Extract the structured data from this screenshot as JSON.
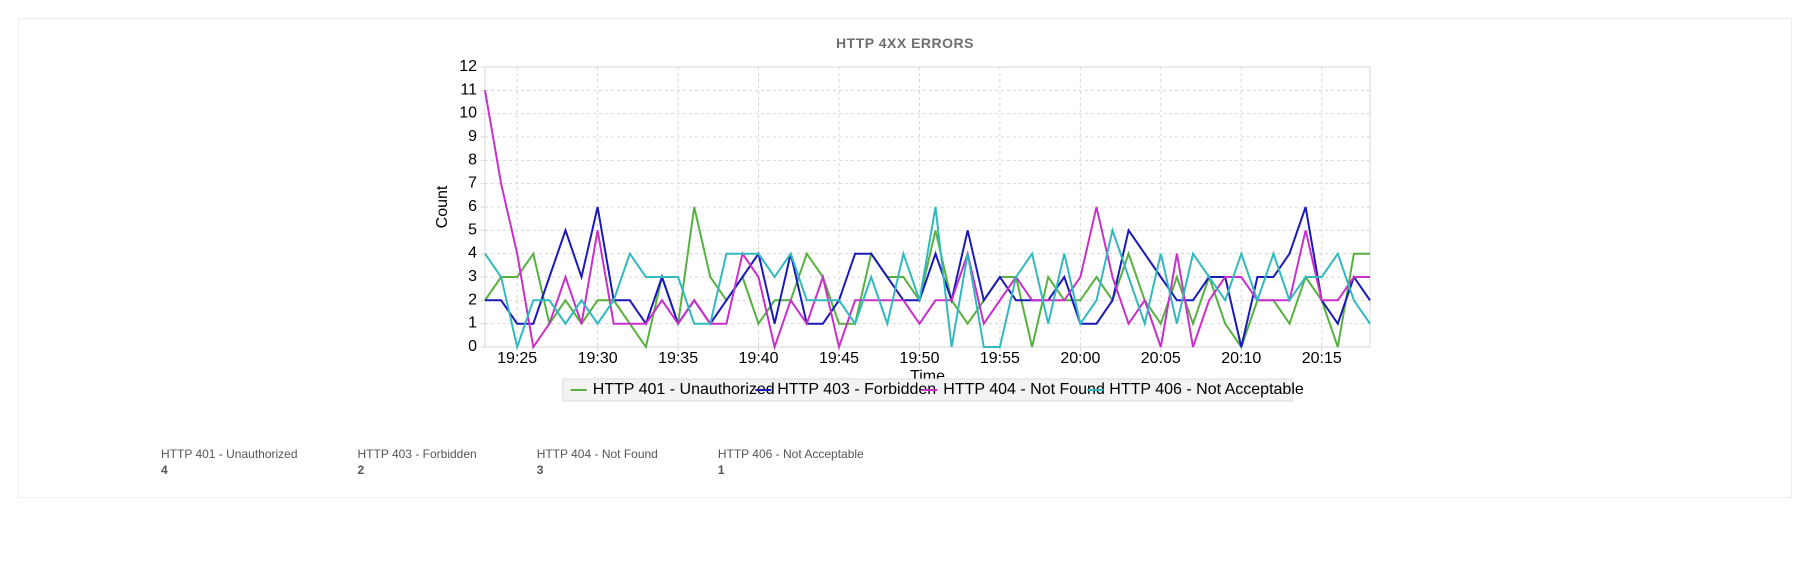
{
  "title": "HTTP 4XX ERRORS",
  "xlabel": "Time",
  "ylabel": "Count",
  "x_ticks": [
    "19:25",
    "19:30",
    "19:35",
    "19:40",
    "19:45",
    "19:50",
    "19:55",
    "20:00",
    "20:05",
    "20:10",
    "20:15"
  ],
  "y_ticks": [
    0,
    1,
    2,
    3,
    4,
    5,
    6,
    7,
    8,
    9,
    10,
    11,
    12
  ],
  "legend": [
    {
      "name": "HTTP 401 - Unauthorized",
      "color": "#57b140"
    },
    {
      "name": "HTTP 403 - Forbidden",
      "color": "#1a1ab8"
    },
    {
      "name": "HTTP 404 - Not Found",
      "color": "#c930c9"
    },
    {
      "name": "HTTP 406 - Not Acceptable",
      "color": "#32b9bf"
    }
  ],
  "stats": [
    {
      "label": "HTTP 401 - Unauthorized",
      "value": "4"
    },
    {
      "label": "HTTP 403 - Forbidden",
      "value": "2"
    },
    {
      "label": "HTTP 404 - Not Found",
      "value": "3"
    },
    {
      "label": "HTTP 406 - Not Acceptable",
      "value": "1"
    }
  ],
  "chart_data": {
    "type": "line",
    "title": "HTTP 4XX ERRORS",
    "xlabel": "Time",
    "ylabel": "Count",
    "ylim": [
      0,
      12
    ],
    "x": [
      0,
      1,
      2,
      3,
      4,
      5,
      6,
      7,
      8,
      9,
      10,
      11,
      12,
      13,
      14,
      15,
      16,
      17,
      18,
      19,
      20,
      21,
      22,
      23,
      24,
      25,
      26,
      27,
      28,
      29,
      30,
      31,
      32,
      33,
      34,
      35,
      36,
      37,
      38,
      39,
      40,
      41,
      42,
      43,
      44,
      45,
      46,
      47,
      48,
      49,
      50,
      51,
      52,
      53,
      54,
      55
    ],
    "x_tick_positions": [
      2,
      7,
      12,
      17,
      22,
      27,
      32,
      37,
      42,
      47,
      52
    ],
    "x_tick_labels": [
      "19:25",
      "19:30",
      "19:35",
      "19:40",
      "19:45",
      "19:50",
      "19:55",
      "20:00",
      "20:05",
      "20:10",
      "20:15"
    ],
    "series": [
      {
        "name": "HTTP 401 - Unauthorized",
        "color": "#57b140",
        "values": [
          2,
          3,
          3,
          4,
          1,
          2,
          1,
          2,
          2,
          1,
          0,
          3,
          1,
          6,
          3,
          2,
          3,
          1,
          2,
          2,
          4,
          3,
          1,
          1,
          4,
          3,
          3,
          2,
          5,
          2,
          1,
          2,
          3,
          3,
          0,
          3,
          2,
          2,
          3,
          2,
          4,
          2,
          1,
          3,
          1,
          3,
          1,
          0,
          2,
          2,
          1,
          3,
          2,
          0,
          4,
          4
        ]
      },
      {
        "name": "HTTP 403 - Forbidden",
        "color": "#1a1ab8",
        "values": [
          2,
          2,
          1,
          1,
          3,
          5,
          3,
          6,
          2,
          2,
          1,
          3,
          1,
          2,
          1,
          2,
          3,
          4,
          1,
          4,
          1,
          1,
          2,
          4,
          4,
          3,
          2,
          2,
          4,
          2,
          5,
          2,
          3,
          2,
          2,
          2,
          3,
          1,
          1,
          2,
          5,
          4,
          3,
          2,
          2,
          3,
          3,
          0,
          3,
          3,
          4,
          6,
          2,
          1,
          3,
          2
        ]
      },
      {
        "name": "HTTP 404 - Not Found",
        "color": "#c930c9",
        "values": [
          11,
          7,
          4,
          0,
          1,
          3,
          1,
          5,
          1,
          1,
          1,
          2,
          1,
          2,
          1,
          1,
          4,
          3,
          0,
          2,
          1,
          3,
          0,
          2,
          2,
          2,
          2,
          1,
          2,
          2,
          4,
          1,
          2,
          3,
          2,
          2,
          2,
          3,
          6,
          3,
          1,
          2,
          0,
          4,
          0,
          2,
          3,
          3,
          2,
          2,
          2,
          5,
          2,
          2,
          3,
          3
        ]
      },
      {
        "name": "HTTP 406 - Not Acceptable",
        "color": "#32b9bf",
        "values": [
          4,
          3,
          0,
          2,
          2,
          1,
          2,
          1,
          2,
          4,
          3,
          3,
          3,
          1,
          1,
          4,
          4,
          4,
          3,
          4,
          2,
          2,
          2,
          1,
          3,
          1,
          4,
          2,
          6,
          0,
          4,
          0,
          0,
          3,
          4,
          1,
          4,
          1,
          2,
          5,
          3,
          1,
          4,
          1,
          4,
          3,
          2,
          4,
          2,
          4,
          2,
          3,
          3,
          4,
          2,
          1
        ]
      }
    ]
  }
}
